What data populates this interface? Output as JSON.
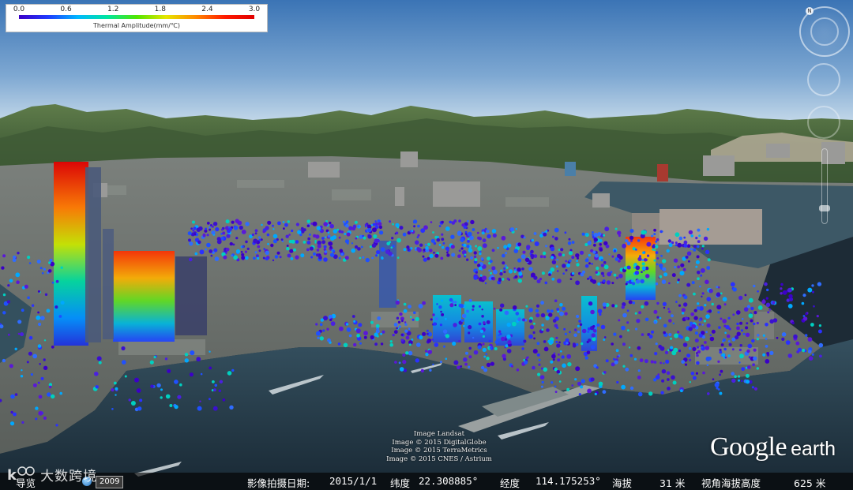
{
  "legend": {
    "ticks": [
      "0.0",
      "0.6",
      "1.2",
      "1.8",
      "2.4",
      "3.0"
    ],
    "title": "Thermal Amplitude(mm/℃)",
    "colors": [
      "#3b00c8",
      "#1f3cff",
      "#00b8ff",
      "#00e6a0",
      "#50e600",
      "#e6e600",
      "#ff8a00",
      "#ff1a00",
      "#e00000"
    ]
  },
  "credits": {
    "lines": [
      "Image Landsat",
      "Image © 2015 DigitalGlobe",
      "Image © 2015 TerraMetrics",
      "Image © 2015 CNES / Astrium"
    ]
  },
  "logo": {
    "primary": "Google",
    "secondary": "earth"
  },
  "status": {
    "nav_label": "导览",
    "year": "2009",
    "date_label": "影像拍摄日期:",
    "date_value": "2015/1/1",
    "lat_label": "纬度",
    "lat_value": "22.308885°",
    "lon_label": "经度",
    "lon_value": "114.175253°",
    "elev_label": "海拔",
    "elev_value": "31 米",
    "eye_label": "视角海拔高度",
    "eye_value": "625 米"
  },
  "watermark": {
    "text": "大数跨境"
  },
  "icons": {
    "compass": "compass-icon",
    "look": "look-joystick-icon",
    "move": "move-joystick-icon",
    "zoom": "zoom-slider-icon",
    "history": "historical-imagery-icon"
  },
  "colors": {
    "sky_top": "#3f78b8",
    "sky_bottom": "#bcd4e6",
    "water": "#23394a",
    "land": "#6a6f6d"
  }
}
